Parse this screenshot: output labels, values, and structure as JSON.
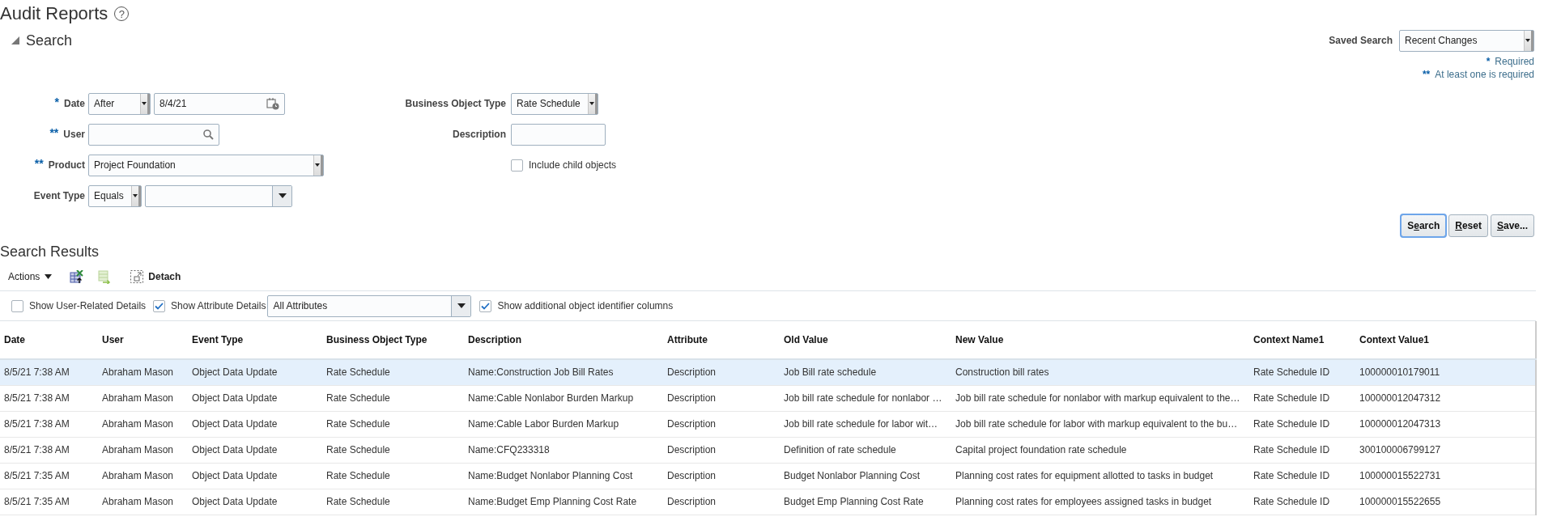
{
  "page": {
    "title": "Audit Reports",
    "help_glyph": "?"
  },
  "search": {
    "title": "Search",
    "expanded": true,
    "saved_search": {
      "label": "Saved Search",
      "value": "Recent Changes"
    },
    "legend": [
      {
        "marker": "*",
        "text": "Required"
      },
      {
        "marker": "**",
        "text": "At least one is required"
      }
    ],
    "fields": [
      {
        "kind": "date",
        "label": "Date",
        "marker": "*",
        "operator": "After",
        "value": "8/4/21"
      },
      {
        "kind": "lookup",
        "label": "User",
        "marker": "**"
      },
      {
        "kind": "select",
        "label": "Product",
        "marker": "**",
        "value": "Project Foundation"
      },
      {
        "kind": "operator-select",
        "label": "Event Type",
        "operator": "Equals"
      }
    ],
    "side_fields": [
      {
        "kind": "select",
        "label": "Business Object Type",
        "value": "Rate Schedule"
      },
      {
        "kind": "text",
        "label": "Description"
      },
      {
        "kind": "checkbox",
        "label": "Include child objects",
        "checked": false
      }
    ],
    "buttons": [
      {
        "before": "S",
        "key": "e",
        "after": "arch",
        "focused": true
      },
      {
        "key": "R",
        "after": "eset",
        "focused": false
      },
      {
        "key": "S",
        "after": "ave...",
        "focused": false
      }
    ]
  },
  "results": {
    "title": "Search Results",
    "toolbar": {
      "actions": "Actions",
      "detach": "Detach"
    },
    "filters": [
      {
        "kind": "checkbox",
        "label": "Show User-Related Details",
        "checked": false
      },
      {
        "kind": "checkbox",
        "label": "Show Attribute Details",
        "checked": true
      },
      {
        "kind": "select",
        "value": "All Attributes"
      },
      {
        "kind": "checkbox",
        "label": "Show additional object identifier columns",
        "checked": true
      }
    ],
    "table": {
      "columns": [
        "Date",
        "User",
        "Event Type",
        "Business Object Type",
        "Description",
        "Attribute",
        "Old Value",
        "New Value",
        "Context Name1",
        "Context Value1"
      ],
      "rows": [
        {
          "selected": true,
          "cells": [
            "8/5/21 7:38 AM",
            "Abraham Mason",
            "Object Data Update",
            "Rate Schedule",
            "Name:Construction Job Bill Rates",
            "Description",
            "Job Bill rate schedule",
            "Construction bill rates",
            "Rate Schedule ID",
            "100000010179011"
          ]
        },
        {
          "selected": false,
          "cells": [
            "8/5/21 7:38 AM",
            "Abraham Mason",
            "Object Data Update",
            "Rate Schedule",
            "Name:Cable Nonlabor Burden Markup",
            "Description",
            "Job bill rate schedule for nonlabor …",
            "Job bill rate schedule for nonlabor with markup equivalent to the…",
            "Rate Schedule ID",
            "100000012047312"
          ]
        },
        {
          "selected": false,
          "cells": [
            "8/5/21 7:38 AM",
            "Abraham Mason",
            "Object Data Update",
            "Rate Schedule",
            "Name:Cable Labor Burden Markup",
            "Description",
            "Job bill rate schedule for labor wit…",
            "Job bill rate schedule for labor with markup equivalent to the bu…",
            "Rate Schedule ID",
            "100000012047313"
          ]
        },
        {
          "selected": false,
          "cells": [
            "8/5/21 7:38 AM",
            "Abraham Mason",
            "Object Data Update",
            "Rate Schedule",
            "Name:CFQ233318",
            "Description",
            "Definition of rate schedule",
            "Capital project foundation rate schedule",
            "Rate Schedule ID",
            "300100006799127"
          ]
        },
        {
          "selected": false,
          "cells": [
            "8/5/21 7:35 AM",
            "Abraham Mason",
            "Object Data Update",
            "Rate Schedule",
            "Name:Budget Nonlabor Planning Cost",
            "Description",
            "Budget Nonlabor Planning Cost",
            "Planning cost rates for equipment allotted to tasks in budget",
            "Rate Schedule ID",
            "100000015522731"
          ]
        },
        {
          "selected": false,
          "cells": [
            "8/5/21 7:35 AM",
            "Abraham Mason",
            "Object Data Update",
            "Rate Schedule",
            "Name:Budget Emp Planning Cost Rate",
            "Description",
            "Budget Emp Planning Cost Rate",
            "Planning cost rates for employees assigned tasks in budget",
            "Rate Schedule ID",
            "100000015522655"
          ]
        }
      ]
    }
  }
}
